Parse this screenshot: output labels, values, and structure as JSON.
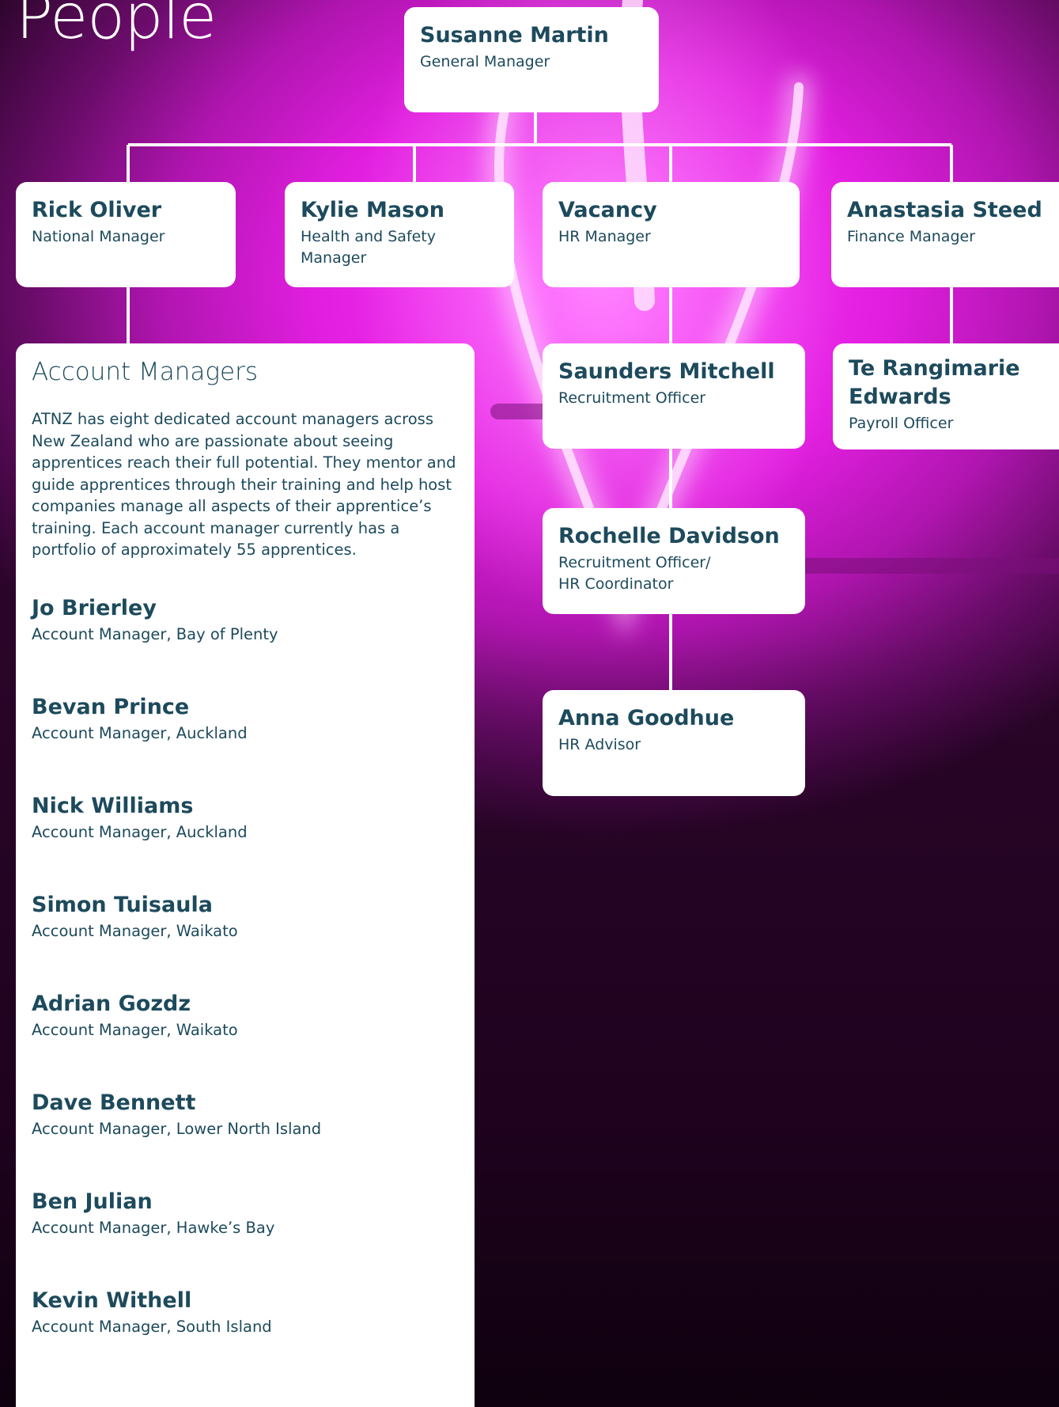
{
  "page": {
    "title": "People"
  },
  "colors": {
    "card_text": "#1d4a5c",
    "background_accent": "#ee2cec",
    "card_bg": "#ffffff"
  },
  "org": {
    "gm": {
      "name": "Susanne Martin",
      "role": "General Manager"
    },
    "managers": [
      {
        "name": "Rick Oliver",
        "role": "National Manager"
      },
      {
        "name": "Kylie Mason",
        "role": "Health and Safety Manager"
      },
      {
        "name": "Vacancy",
        "role": "HR Manager"
      },
      {
        "name": "Anastasia Steed",
        "role": "Finance Manager"
      }
    ],
    "hr_team": [
      {
        "name": "Saunders Mitchell",
        "role": "Recruitment Officer"
      },
      {
        "name": "Rochelle Davidson",
        "role": "Recruitment Officer/ HR Coordinator"
      },
      {
        "name": "Anna Goodhue",
        "role": "HR Advisor"
      }
    ],
    "finance_team": [
      {
        "name": "Te Rangimarie Edwards",
        "role": "Payroll Officer"
      }
    ]
  },
  "account_managers": {
    "heading": "Account Managers",
    "description": "ATNZ has eight dedicated account managers across New Zealand who are passionate about seeing apprentices reach their full potential. They mentor and guide apprentices through their training and help host companies manage all aspects of their apprentice’s training. Each account manager currently has a portfolio of approximately 55 apprentices.",
    "people": [
      {
        "name": "Jo Brierley",
        "role": "Account Manager, Bay of Plenty"
      },
      {
        "name": "Bevan Prince",
        "role": "Account Manager, Auckland"
      },
      {
        "name": "Nick Williams",
        "role": "Account Manager, Auckland"
      },
      {
        "name": "Simon Tuisaula",
        "role": "Account Manager, Waikato"
      },
      {
        "name": "Adrian Gozdz",
        "role": "Account Manager, Waikato"
      },
      {
        "name": "Dave Bennett",
        "role": "Account Manager, Lower North Island"
      },
      {
        "name": "Ben Julian",
        "role": "Account Manager, Hawke’s Bay"
      },
      {
        "name": "Kevin Withell",
        "role": "Account Manager, South Island"
      }
    ]
  }
}
